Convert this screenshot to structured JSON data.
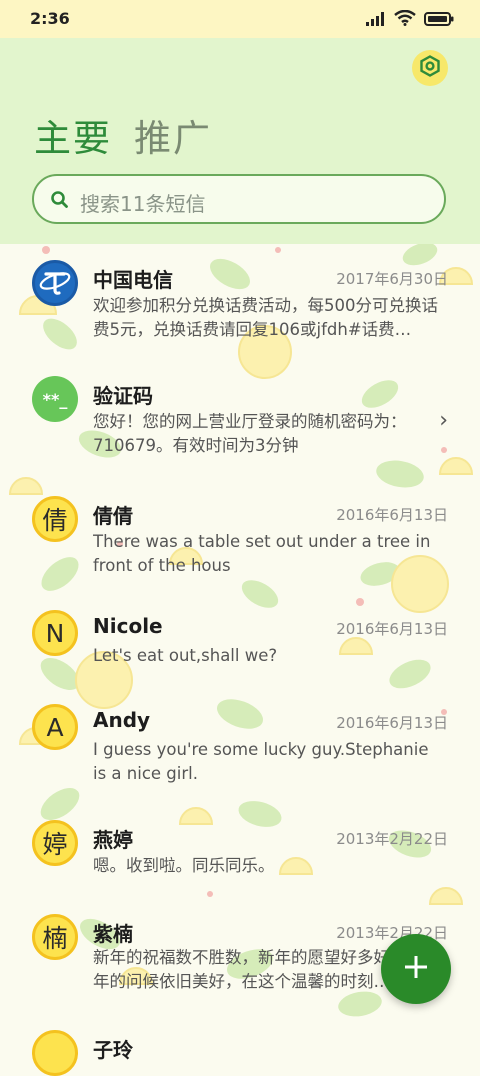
{
  "status_bar": {
    "time": "2:36"
  },
  "header": {
    "tabs": [
      {
        "label": "主要",
        "active": true
      },
      {
        "label": "推广",
        "active": false
      }
    ],
    "search": {
      "placeholder": "搜索11条短信"
    }
  },
  "conversations": [
    {
      "name": "中国电信",
      "date": "2017年6月30日",
      "preview": "欢迎参加积分兑换话费活动，每500分可兑换话费5元，兑换话费请回复106或jfdh#话费…",
      "avatar": {
        "type": "logo",
        "icon": "china-telecom-logo"
      }
    },
    {
      "name": "验证码",
      "date": "",
      "preview": "您好！您的网上营业厅登录的随机密码为：710679。有效时间为3分钟",
      "avatar": {
        "type": "code",
        "text": "**_"
      },
      "has_chevron": true
    },
    {
      "name": "倩倩",
      "date": "2016年6月13日",
      "preview": "There was a table set out under a tree in front of the hous",
      "avatar": {
        "type": "letter",
        "text": "倩"
      }
    },
    {
      "name": "Nicole",
      "date": "2016年6月13日",
      "preview": "Let's eat out,shall we?",
      "avatar": {
        "type": "letter",
        "text": "N"
      }
    },
    {
      "name": "Andy",
      "date": "2016年6月13日",
      "preview": "I guess you're some lucky guy.Stephanie is a nice girl.",
      "avatar": {
        "type": "letter",
        "text": "A"
      }
    },
    {
      "name": "燕婷",
      "date": "2013年2月22日",
      "preview": "嗯。收到啦。同乐同乐。",
      "avatar": {
        "type": "letter",
        "text": "婷"
      }
    },
    {
      "name": "紫楠",
      "date": "2013年2月22日",
      "preview": "新年的祝福数不胜数，新年的愿望好多好多，新年的问候依旧美好，在这个温馨的时刻…",
      "avatar": {
        "type": "letter",
        "text": "楠"
      }
    },
    {
      "name": "子玲",
      "date": "",
      "preview": "",
      "avatar": {
        "type": "letter",
        "text": ""
      }
    }
  ],
  "colors": {
    "accent": "#2a8a29",
    "header_bg": "#e2f5cd",
    "status_bg": "#fdf6c3",
    "avatar_yellow": "#fde34e"
  }
}
